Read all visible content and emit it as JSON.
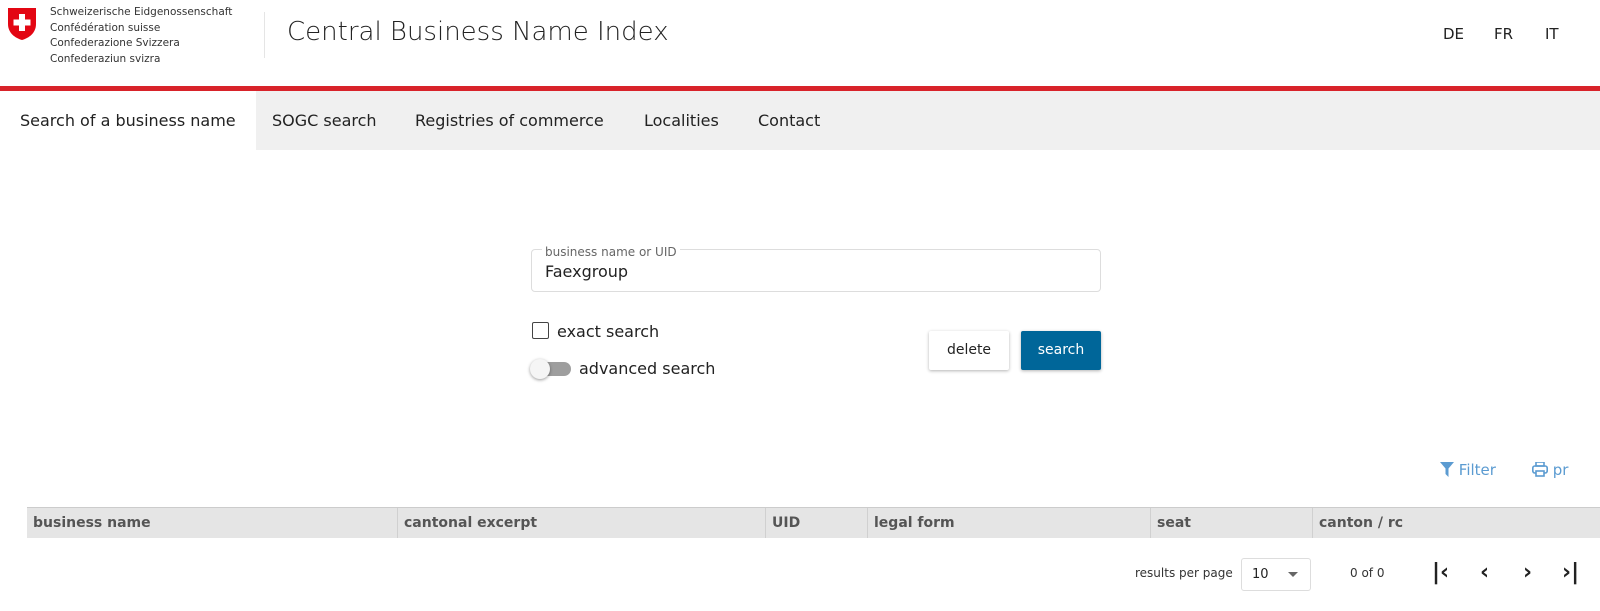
{
  "header": {
    "federation_lines": [
      "Schweizerische Eidgenossenschaft",
      "Confédération suisse",
      "Confederazione Svizzera",
      "Confederaziun svizra"
    ],
    "title": "Central Business Name Index",
    "languages": [
      "DE",
      "FR",
      "IT"
    ]
  },
  "nav": {
    "tabs": [
      {
        "label": "Search of a business name",
        "active": true
      },
      {
        "label": "SOGC search"
      },
      {
        "label": "Registries of commerce"
      },
      {
        "label": "Localities"
      },
      {
        "label": "Contact"
      }
    ]
  },
  "search": {
    "field_label": "business name or UID",
    "value": "Faexgroup",
    "exact_label": "exact search",
    "exact_checked": false,
    "advanced_label": "advanced search",
    "advanced_on": false,
    "delete_label": "delete",
    "search_label": "search"
  },
  "tools": {
    "filter_label": "Filter",
    "print_label": "pr"
  },
  "table": {
    "columns": [
      "business name",
      "cantonal excerpt",
      "UID",
      "legal form",
      "seat",
      "canton / rc"
    ]
  },
  "pagination": {
    "per_page_label": "results per page",
    "per_page": "10",
    "range": "0 of 0"
  },
  "colors": {
    "accent_red": "#d8232a",
    "primary_button": "#006699",
    "link_blue": "#5b9bd1"
  }
}
